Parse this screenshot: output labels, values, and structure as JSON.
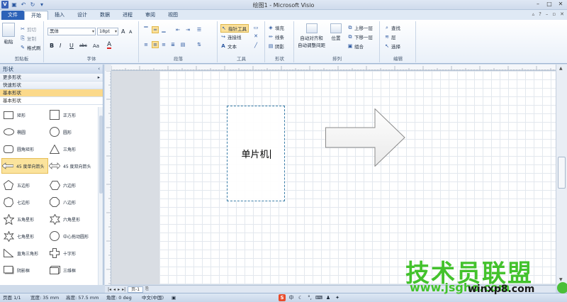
{
  "window": {
    "title": "绘图1 - Microsoft Visio"
  },
  "tabs": [
    "文件",
    "开始",
    "插入",
    "设计",
    "数据",
    "进程",
    "审阅",
    "视图"
  ],
  "ribbon": {
    "clipboard": {
      "paste": "粘贴",
      "cut": "剪切",
      "copy": "复制",
      "format_painter": "格式刷",
      "label": "剪贴板"
    },
    "font": {
      "family": "黑体",
      "size": "18pt",
      "grow": "A",
      "shrink": "A",
      "bold": "B",
      "italic": "I",
      "underline": "U",
      "strike": "abc",
      "case": "Aa",
      "color": "A",
      "label": "字体"
    },
    "paragraph": {
      "label": "段落"
    },
    "tools": {
      "pointer": "指针工具",
      "connector": "连接线",
      "text": "文本",
      "label": "工具"
    },
    "shape": {
      "fill": "填充",
      "line": "线条",
      "shadow": "阴影",
      "label": "形状"
    },
    "arrange": {
      "auto_align": "自动对齐和",
      "auto_space": "自动调整间距",
      "position": "位置",
      "bring_forward": "上移一层",
      "send_backward": "下移一层",
      "group": "组合",
      "label": "排列"
    },
    "editing": {
      "find": "查找",
      "layers": "层",
      "select": "选择",
      "label": "编辑"
    }
  },
  "shapes_pane": {
    "title": "形状",
    "more_shapes": "更多形状",
    "quick_shapes": "快速形状",
    "basic_shapes": "基本形状",
    "stencil_title": "基本形状",
    "items": [
      "矩形",
      "正方形",
      "椭圆",
      "圆形",
      "圆角矩形",
      "三角形",
      "45 度单向箭头",
      "45 度双向箭头",
      "五边形",
      "六边形",
      "七边形",
      "八边形",
      "五角星形",
      "六角星形",
      "七角星形",
      "中心拖动圆形",
      "直角三角形",
      "十字形",
      "阴影框",
      "三维框"
    ]
  },
  "canvas": {
    "shape_text": "单片机"
  },
  "sheet_tab": "页-1",
  "status": {
    "page": "页面 1/1",
    "width": "宽度: 35 mm",
    "height": "高度: 57.5 mm",
    "angle": "角度: 0 deg",
    "language": "中文(中国)"
  },
  "watermark": {
    "line1": "技术员联盟",
    "url_left": "www.jsgho.com",
    "url_right": "winxp8.com"
  },
  "colors": {
    "file_tab": "#2c62b8",
    "selection": "#fbe09a",
    "watermark_green": "#43c22c"
  }
}
